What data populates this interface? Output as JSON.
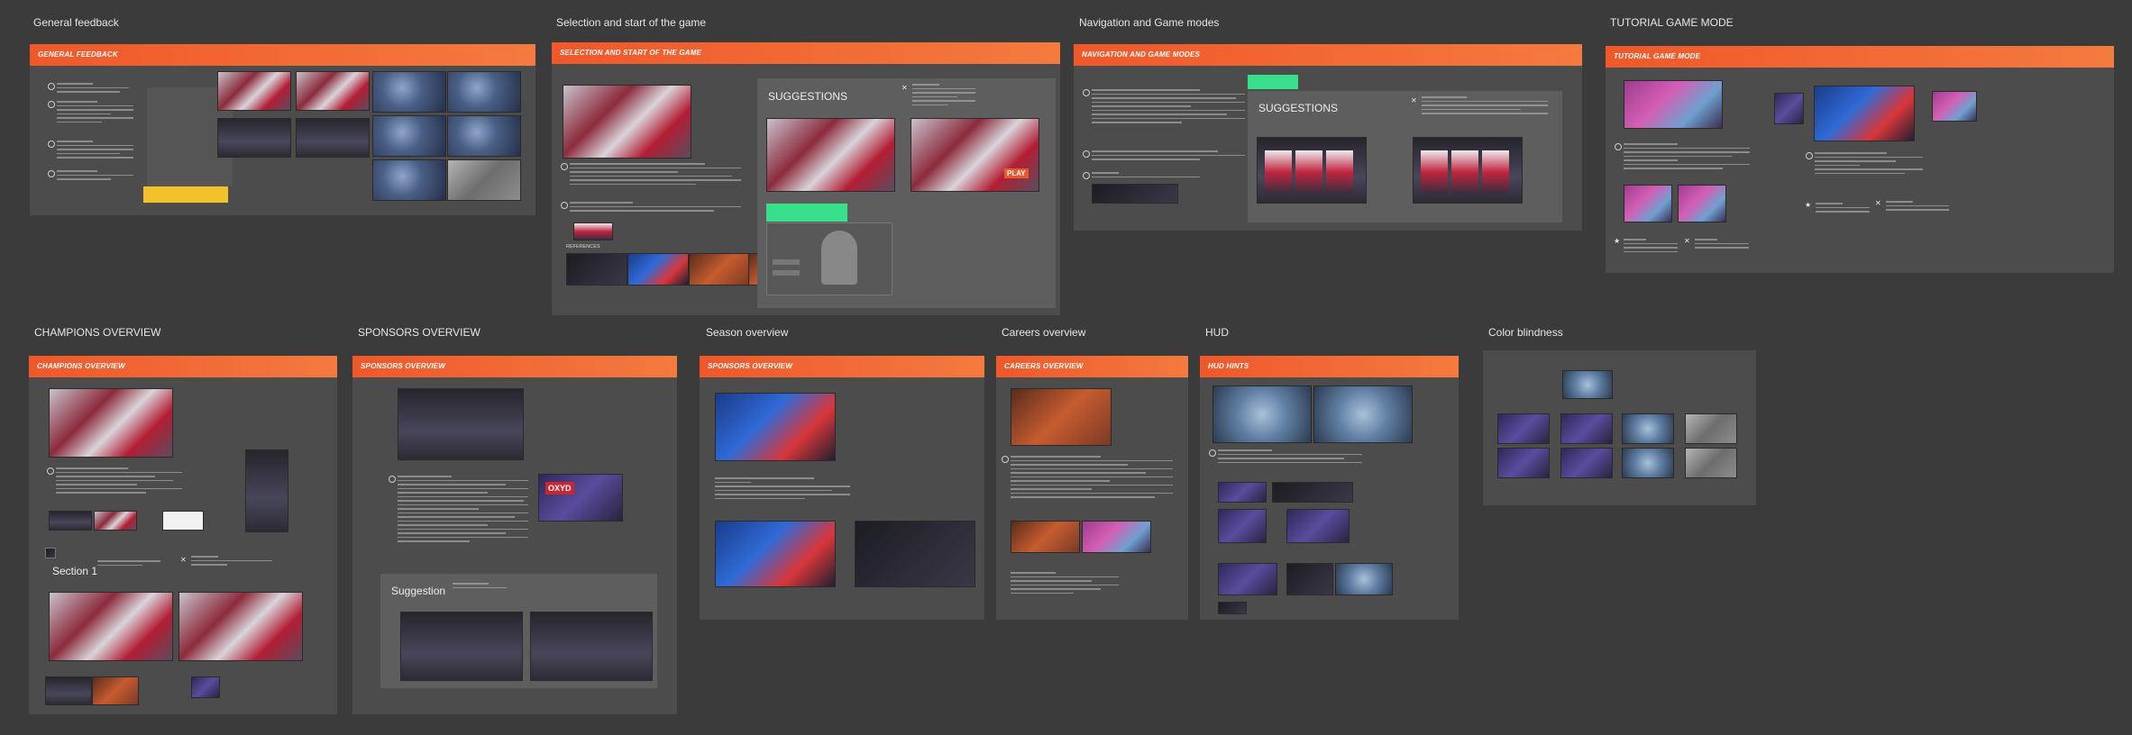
{
  "frames": {
    "general": {
      "title": "General feedback",
      "header": "GENERAL FEEDBACK"
    },
    "selection": {
      "title": "Selection and start of the game",
      "header": "SELECTION AND START OF THE GAME",
      "suggestions": "SUGGESTIONS",
      "references": "REFERENCES",
      "play": "PLAY"
    },
    "navigation": {
      "title": "Navigation and Game modes",
      "header": "NAVIGATION AND GAME MODES",
      "suggestions": "SUGGESTIONS"
    },
    "tutorial": {
      "title": "TUTORIAL GAME MODE",
      "header": "TUTORIAL GAME MODE"
    },
    "champions": {
      "title": "CHAMPIONS OVERVIEW",
      "header": "CHAMPIONS OVERVIEW",
      "section": "Section 1"
    },
    "sponsors": {
      "title": "SPONSORS OVERVIEW",
      "header": "SPONSORS OVERVIEW",
      "suggestion": "Suggestion",
      "brand": "OXYD"
    },
    "season": {
      "title": "Season overview",
      "header": "SPONSORS OVERVIEW"
    },
    "careers": {
      "title": "Careers overview",
      "header": "CAREERS OVERVIEW"
    },
    "hud": {
      "title": "HUD",
      "header": "HUD HINTS"
    },
    "color": {
      "title": "Color blindness"
    }
  }
}
